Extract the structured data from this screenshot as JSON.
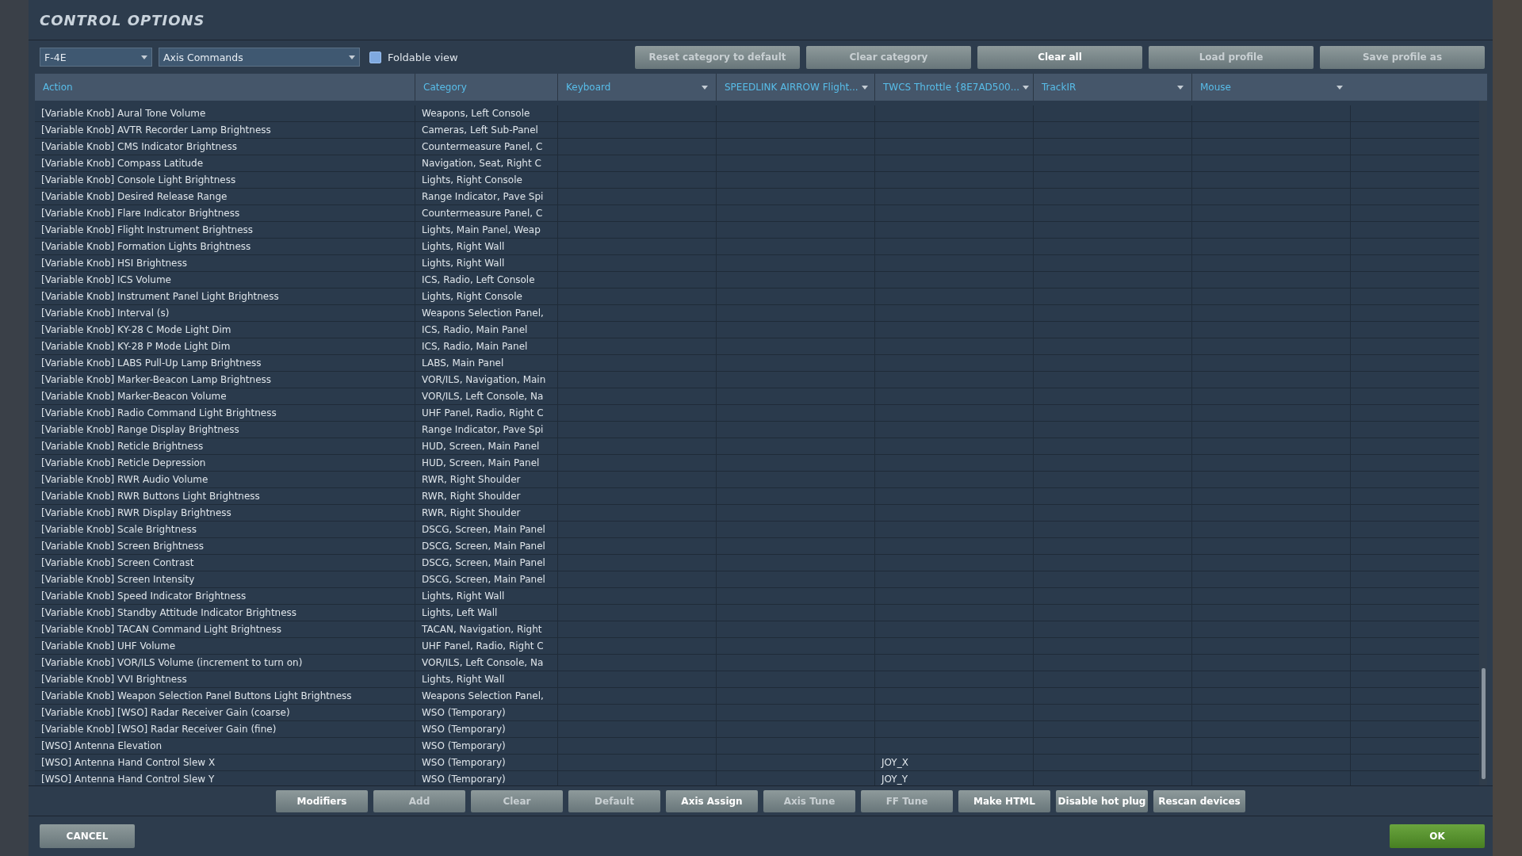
{
  "window": {
    "title": "CONTROL OPTIONS"
  },
  "toolbar": {
    "aircraft": "F-4E",
    "category": "Axis Commands",
    "foldable_view": {
      "label": "Foldable view",
      "checked": false
    },
    "buttons": [
      {
        "label": "Reset category to default",
        "disabled": true
      },
      {
        "label": "Clear category",
        "disabled": true
      },
      {
        "label": "Clear all",
        "disabled": false
      },
      {
        "label": "Load profile",
        "disabled": true
      },
      {
        "label": "Save profile as",
        "disabled": true
      }
    ]
  },
  "table": {
    "columns": [
      {
        "label": "Action",
        "dropdown": false
      },
      {
        "label": "Category",
        "dropdown": false
      },
      {
        "label": "Keyboard",
        "dropdown": true
      },
      {
        "label": "SPEEDLINK AIRROW Flight...",
        "dropdown": true
      },
      {
        "label": "TWCS Throttle {8E7AD500...",
        "dropdown": true
      },
      {
        "label": "TrackIR",
        "dropdown": true
      },
      {
        "label": "Mouse",
        "dropdown": true
      }
    ],
    "rows": [
      {
        "action": "[Variable Knob] Aural Tone Volume",
        "category": "Weapons, Left Console"
      },
      {
        "action": "[Variable Knob] AVTR Recorder Lamp Brightness",
        "category": "Cameras, Left Sub-Panel"
      },
      {
        "action": "[Variable Knob] CMS Indicator Brightness",
        "category": "Countermeasure Panel, C"
      },
      {
        "action": "[Variable Knob] Compass Latitude",
        "category": "Navigation, Seat, Right C"
      },
      {
        "action": "[Variable Knob] Console Light Brightness",
        "category": "Lights, Right Console"
      },
      {
        "action": "[Variable Knob] Desired Release Range",
        "category": "Range Indicator, Pave Spi"
      },
      {
        "action": "[Variable Knob] Flare Indicator Brightness",
        "category": "Countermeasure Panel, C"
      },
      {
        "action": "[Variable Knob] Flight Instrument Brightness",
        "category": "Lights, Main Panel, Weap"
      },
      {
        "action": "[Variable Knob] Formation Lights Brightness",
        "category": "Lights, Right Wall"
      },
      {
        "action": "[Variable Knob] HSI Brightness",
        "category": "Lights, Right Wall"
      },
      {
        "action": "[Variable Knob] ICS Volume",
        "category": "ICS, Radio, Left Console"
      },
      {
        "action": "[Variable Knob] Instrument Panel Light Brightness",
        "category": "Lights, Right Console"
      },
      {
        "action": "[Variable Knob] Interval (s)",
        "category": "Weapons Selection Panel,"
      },
      {
        "action": "[Variable Knob] KY-28 C Mode Light Dim",
        "category": "ICS, Radio, Main Panel"
      },
      {
        "action": "[Variable Knob] KY-28 P Mode Light Dim",
        "category": "ICS, Radio, Main Panel"
      },
      {
        "action": "[Variable Knob] LABS Pull-Up Lamp Brightness",
        "category": "LABS, Main Panel"
      },
      {
        "action": "[Variable Knob] Marker-Beacon Lamp Brightness",
        "category": "VOR/ILS, Navigation, Main"
      },
      {
        "action": "[Variable Knob] Marker-Beacon Volume",
        "category": "VOR/ILS, Left Console, Na"
      },
      {
        "action": "[Variable Knob] Radio Command Light Brightness",
        "category": "UHF Panel, Radio, Right C"
      },
      {
        "action": "[Variable Knob] Range Display Brightness",
        "category": "Range Indicator, Pave Spi"
      },
      {
        "action": "[Variable Knob] Reticle Brightness",
        "category": "HUD, Screen, Main Panel"
      },
      {
        "action": "[Variable Knob] Reticle Depression",
        "category": "HUD, Screen, Main Panel"
      },
      {
        "action": "[Variable Knob] RWR Audio Volume",
        "category": "RWR, Right Shoulder"
      },
      {
        "action": "[Variable Knob] RWR Buttons Light Brightness",
        "category": "RWR, Right Shoulder"
      },
      {
        "action": "[Variable Knob] RWR Display Brightness",
        "category": "RWR, Right Shoulder"
      },
      {
        "action": "[Variable Knob] Scale Brightness",
        "category": "DSCG, Screen, Main Panel"
      },
      {
        "action": "[Variable Knob] Screen Brightness",
        "category": "DSCG, Screen, Main Panel"
      },
      {
        "action": "[Variable Knob] Screen Contrast",
        "category": "DSCG, Screen, Main Panel"
      },
      {
        "action": "[Variable Knob] Screen Intensity",
        "category": "DSCG, Screen, Main Panel"
      },
      {
        "action": "[Variable Knob] Speed Indicator Brightness",
        "category": "Lights, Right Wall"
      },
      {
        "action": "[Variable Knob] Standby Attitude Indicator Brightness",
        "category": "Lights, Left Wall"
      },
      {
        "action": "[Variable Knob] TACAN Command Light Brightness",
        "category": "TACAN, Navigation, Right"
      },
      {
        "action": "[Variable Knob] UHF Volume",
        "category": "UHF Panel, Radio, Right C"
      },
      {
        "action": "[Variable Knob] VOR/ILS Volume (increment to turn on)",
        "category": "VOR/ILS, Left Console, Na"
      },
      {
        "action": "[Variable Knob] VVI Brightness",
        "category": "Lights, Right Wall"
      },
      {
        "action": "[Variable Knob] Weapon Selection Panel Buttons Light Brightness",
        "category": "Weapons Selection Panel,"
      },
      {
        "action": "[Variable Knob] [WSO] Radar Receiver Gain (coarse)",
        "category": "WSO (Temporary)"
      },
      {
        "action": "[Variable Knob] [WSO] Radar Receiver Gain (fine)",
        "category": "WSO (Temporary)"
      },
      {
        "action": "[WSO] Antenna Elevation",
        "category": "WSO (Temporary)"
      },
      {
        "action": "[WSO] Antenna Hand Control Slew X",
        "category": "WSO (Temporary)",
        "twcs_throttle": "JOY_X"
      },
      {
        "action": "[WSO] Antenna Hand Control Slew Y",
        "category": "WSO (Temporary)",
        "twcs_throttle": "JOY_Y"
      }
    ]
  },
  "action_buttons": [
    {
      "label": "Modifiers",
      "disabled": false
    },
    {
      "label": "Add",
      "disabled": true
    },
    {
      "label": "Clear",
      "disabled": true
    },
    {
      "label": "Default",
      "disabled": true
    },
    {
      "label": "Axis Assign",
      "disabled": false
    },
    {
      "label": "Axis Tune",
      "disabled": true
    },
    {
      "label": "FF Tune",
      "disabled": true
    },
    {
      "label": "Make HTML",
      "disabled": false
    },
    {
      "label": "Disable hot plug",
      "disabled": false
    },
    {
      "label": "Rescan devices",
      "disabled": false
    }
  ],
  "footer": {
    "cancel": "CANCEL",
    "ok": "OK"
  }
}
